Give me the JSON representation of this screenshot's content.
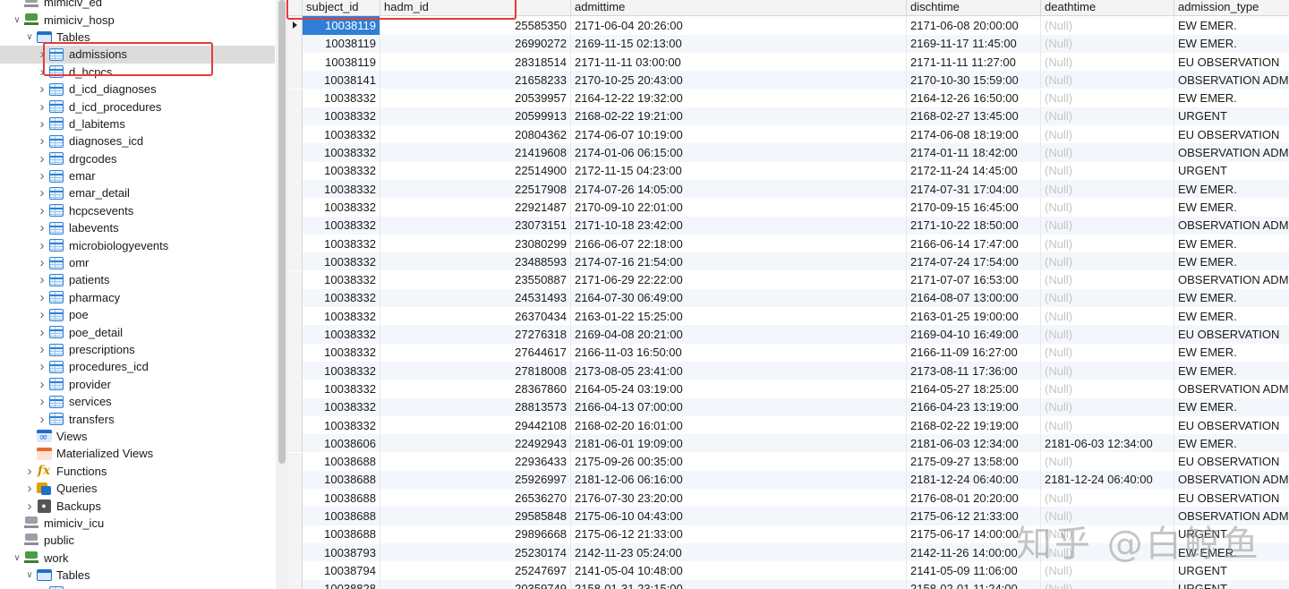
{
  "sidebar": {
    "items": [
      {
        "label": "mimiciv_ed",
        "level": 1,
        "icon": "database-icon",
        "state": "leaf"
      },
      {
        "label": "mimiciv_hosp",
        "level": 1,
        "icon": "database-green-icon",
        "state": "expanded"
      },
      {
        "label": "Tables",
        "level": 2,
        "icon": "tables-folder-icon",
        "state": "expanded"
      },
      {
        "label": "admissions",
        "level": 3,
        "icon": "table-icon",
        "state": "collapsed",
        "selected": true
      },
      {
        "label": "d_hcpcs",
        "level": 3,
        "icon": "table-icon",
        "state": "collapsed"
      },
      {
        "label": "d_icd_diagnoses",
        "level": 3,
        "icon": "table-icon",
        "state": "collapsed"
      },
      {
        "label": "d_icd_procedures",
        "level": 3,
        "icon": "table-icon",
        "state": "collapsed"
      },
      {
        "label": "d_labitems",
        "level": 3,
        "icon": "table-icon",
        "state": "collapsed"
      },
      {
        "label": "diagnoses_icd",
        "level": 3,
        "icon": "table-icon",
        "state": "collapsed"
      },
      {
        "label": "drgcodes",
        "level": 3,
        "icon": "table-icon",
        "state": "collapsed"
      },
      {
        "label": "emar",
        "level": 3,
        "icon": "table-icon",
        "state": "collapsed"
      },
      {
        "label": "emar_detail",
        "level": 3,
        "icon": "table-icon",
        "state": "collapsed"
      },
      {
        "label": "hcpcsevents",
        "level": 3,
        "icon": "table-icon",
        "state": "collapsed"
      },
      {
        "label": "labevents",
        "level": 3,
        "icon": "table-icon",
        "state": "collapsed"
      },
      {
        "label": "microbiologyevents",
        "level": 3,
        "icon": "table-icon",
        "state": "collapsed"
      },
      {
        "label": "omr",
        "level": 3,
        "icon": "table-icon",
        "state": "collapsed"
      },
      {
        "label": "patients",
        "level": 3,
        "icon": "table-icon",
        "state": "collapsed"
      },
      {
        "label": "pharmacy",
        "level": 3,
        "icon": "table-icon",
        "state": "collapsed"
      },
      {
        "label": "poe",
        "level": 3,
        "icon": "table-icon",
        "state": "collapsed"
      },
      {
        "label": "poe_detail",
        "level": 3,
        "icon": "table-icon",
        "state": "collapsed"
      },
      {
        "label": "prescriptions",
        "level": 3,
        "icon": "table-icon",
        "state": "collapsed"
      },
      {
        "label": "procedures_icd",
        "level": 3,
        "icon": "table-icon",
        "state": "collapsed"
      },
      {
        "label": "provider",
        "level": 3,
        "icon": "table-icon",
        "state": "collapsed"
      },
      {
        "label": "services",
        "level": 3,
        "icon": "table-icon",
        "state": "collapsed"
      },
      {
        "label": "transfers",
        "level": 3,
        "icon": "table-icon",
        "state": "collapsed"
      },
      {
        "label": "Views",
        "level": 2,
        "icon": "views-icon",
        "state": "leaf"
      },
      {
        "label": "Materialized Views",
        "level": 2,
        "icon": "materialized-views-icon",
        "state": "leaf"
      },
      {
        "label": "Functions",
        "level": 2,
        "icon": "functions-icon",
        "state": "collapsed"
      },
      {
        "label": "Queries",
        "level": 2,
        "icon": "queries-icon",
        "state": "collapsed"
      },
      {
        "label": "Backups",
        "level": 2,
        "icon": "backups-icon",
        "state": "collapsed"
      },
      {
        "label": "mimiciv_icu",
        "level": 1,
        "icon": "database-icon",
        "state": "leaf"
      },
      {
        "label": "public",
        "level": 1,
        "icon": "database-icon",
        "state": "leaf"
      },
      {
        "label": "work",
        "level": 1,
        "icon": "database-green-icon",
        "state": "expanded"
      },
      {
        "label": "Tables",
        "level": 2,
        "icon": "tables-folder-icon",
        "state": "expanded"
      },
      {
        "label": "",
        "level": 3,
        "icon": "table-icon",
        "state": "collapsed"
      }
    ]
  },
  "grid": {
    "columns": [
      "subject_id",
      "hadm_id",
      "admittime",
      "dischtime",
      "deathtime",
      "admission_type"
    ],
    "null_text": "(Null)",
    "rows": [
      [
        "10038119",
        "25585350",
        "2171-06-04 20:26:00",
        "2171-06-08 20:00:00",
        null,
        "EW EMER."
      ],
      [
        "10038119",
        "26990272",
        "2169-11-15 02:13:00",
        "2169-11-17 11:45:00",
        null,
        "EW EMER."
      ],
      [
        "10038119",
        "28318514",
        "2171-11-11 03:00:00",
        "2171-11-11 11:27:00",
        null,
        "EU OBSERVATION"
      ],
      [
        "10038141",
        "21658233",
        "2170-10-25 20:43:00",
        "2170-10-30 15:59:00",
        null,
        "OBSERVATION ADMI"
      ],
      [
        "10038332",
        "20539957",
        "2164-12-22 19:32:00",
        "2164-12-26 16:50:00",
        null,
        "EW EMER."
      ],
      [
        "10038332",
        "20599913",
        "2168-02-22 19:21:00",
        "2168-02-27 13:45:00",
        null,
        "URGENT"
      ],
      [
        "10038332",
        "20804362",
        "2174-06-07 10:19:00",
        "2174-06-08 18:19:00",
        null,
        "EU OBSERVATION"
      ],
      [
        "10038332",
        "21419608",
        "2174-01-06 06:15:00",
        "2174-01-11 18:42:00",
        null,
        "OBSERVATION ADMI"
      ],
      [
        "10038332",
        "22514900",
        "2172-11-15 04:23:00",
        "2172-11-24 14:45:00",
        null,
        "URGENT"
      ],
      [
        "10038332",
        "22517908",
        "2174-07-26 14:05:00",
        "2174-07-31 17:04:00",
        null,
        "EW EMER."
      ],
      [
        "10038332",
        "22921487",
        "2170-09-10 22:01:00",
        "2170-09-15 16:45:00",
        null,
        "EW EMER."
      ],
      [
        "10038332",
        "23073151",
        "2171-10-18 23:42:00",
        "2171-10-22 18:50:00",
        null,
        "OBSERVATION ADMI"
      ],
      [
        "10038332",
        "23080299",
        "2166-06-07 22:18:00",
        "2166-06-14 17:47:00",
        null,
        "EW EMER."
      ],
      [
        "10038332",
        "23488593",
        "2174-07-16 21:54:00",
        "2174-07-24 17:54:00",
        null,
        "EW EMER."
      ],
      [
        "10038332",
        "23550887",
        "2171-06-29 22:22:00",
        "2171-07-07 16:53:00",
        null,
        "OBSERVATION ADMI"
      ],
      [
        "10038332",
        "24531493",
        "2164-07-30 06:49:00",
        "2164-08-07 13:00:00",
        null,
        "EW EMER."
      ],
      [
        "10038332",
        "26370434",
        "2163-01-22 15:25:00",
        "2163-01-25 19:00:00",
        null,
        "EW EMER."
      ],
      [
        "10038332",
        "27276318",
        "2169-04-08 20:21:00",
        "2169-04-10 16:49:00",
        null,
        "EU OBSERVATION"
      ],
      [
        "10038332",
        "27644617",
        "2166-11-03 16:50:00",
        "2166-11-09 16:27:00",
        null,
        "EW EMER."
      ],
      [
        "10038332",
        "27818008",
        "2173-08-05 23:41:00",
        "2173-08-11 17:36:00",
        null,
        "EW EMER."
      ],
      [
        "10038332",
        "28367860",
        "2164-05-24 03:19:00",
        "2164-05-27 18:25:00",
        null,
        "OBSERVATION ADMI"
      ],
      [
        "10038332",
        "28813573",
        "2166-04-13 07:00:00",
        "2166-04-23 13:19:00",
        null,
        "EW EMER."
      ],
      [
        "10038332",
        "29442108",
        "2168-02-20 16:01:00",
        "2168-02-22 19:19:00",
        null,
        "EU OBSERVATION"
      ],
      [
        "10038606",
        "22492943",
        "2181-06-01 19:09:00",
        "2181-06-03 12:34:00",
        "2181-06-03 12:34:00",
        "EW EMER."
      ],
      [
        "10038688",
        "22936433",
        "2175-09-26 00:35:00",
        "2175-09-27 13:58:00",
        null,
        "EU OBSERVATION"
      ],
      [
        "10038688",
        "25926997",
        "2181-12-06 06:16:00",
        "2181-12-24 06:40:00",
        "2181-12-24 06:40:00",
        "OBSERVATION ADMI"
      ],
      [
        "10038688",
        "26536270",
        "2176-07-30 23:20:00",
        "2176-08-01 20:20:00",
        null,
        "EU OBSERVATION"
      ],
      [
        "10038688",
        "29585848",
        "2175-06-10 04:43:00",
        "2175-06-12 21:33:00",
        null,
        "OBSERVATION ADMI"
      ],
      [
        "10038688",
        "29896668",
        "2175-06-12 21:33:00",
        "2175-06-17 14:00:00",
        null,
        "URGENT"
      ],
      [
        "10038793",
        "25230174",
        "2142-11-23 05:24:00",
        "2142-11-26 14:00:00",
        null,
        "EW EMER."
      ],
      [
        "10038794",
        "25247697",
        "2141-05-04 10:48:00",
        "2141-05-09 11:06:00",
        null,
        "URGENT"
      ],
      [
        "10038828",
        "20359749",
        "2158-01-31 23:15:00",
        "2158-02-01 11:24:00",
        null,
        "URGENT"
      ]
    ]
  },
  "watermark": "知乎 @白鲸鱼",
  "colors": {
    "selection": "#2f7fd6",
    "highlight_box": "#e53b3b",
    "null_text": "#c4c4c4",
    "alt_row": "#f3f7fc"
  }
}
